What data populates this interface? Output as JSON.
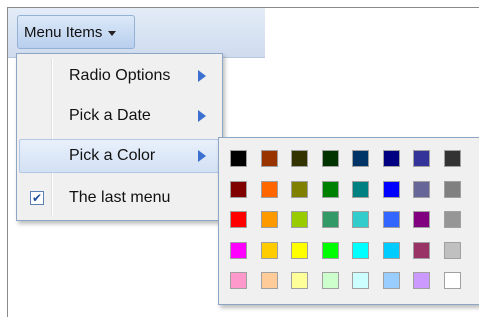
{
  "toolbar": {
    "menu_label": "Menu Items"
  },
  "menu": {
    "items": [
      {
        "label": "Radio Options",
        "submenu": true
      },
      {
        "label": "Pick a Date",
        "submenu": true
      },
      {
        "label": "Pick a Color",
        "submenu": true,
        "active": true
      },
      {
        "label": "The last menu",
        "checked": true
      }
    ],
    "check_glyph": "✔"
  },
  "palette": {
    "colors": [
      [
        "#000000",
        "#993300",
        "#333300",
        "#003300",
        "#003366",
        "#000080",
        "#333399",
        "#333333"
      ],
      [
        "#800000",
        "#FF6600",
        "#808000",
        "#008000",
        "#008080",
        "#0000FF",
        "#666699",
        "#808080"
      ],
      [
        "#FF0000",
        "#FF9900",
        "#99CC00",
        "#339966",
        "#33CCCC",
        "#3366FF",
        "#800080",
        "#969696"
      ],
      [
        "#FF00FF",
        "#FFCC00",
        "#FFFF00",
        "#00FF00",
        "#00FFFF",
        "#00CCFF",
        "#993366",
        "#C0C0C0"
      ],
      [
        "#FF99CC",
        "#FFCC99",
        "#FFFF99",
        "#CCFFCC",
        "#CCFFFF",
        "#99CCFF",
        "#CC99FF",
        "#FFFFFF"
      ]
    ]
  }
}
